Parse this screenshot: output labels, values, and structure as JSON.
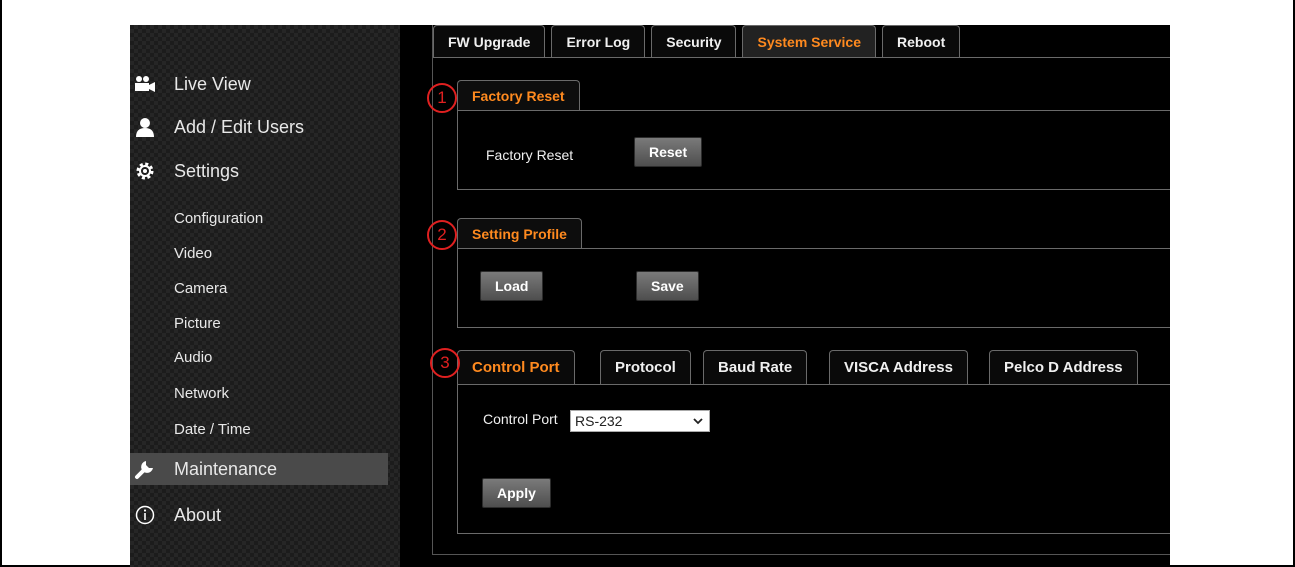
{
  "sidebar": {
    "main_items": [
      {
        "label": "Live View",
        "icon": "video-camera-icon"
      },
      {
        "label": "Add / Edit Users",
        "icon": "user-icon"
      },
      {
        "label": "Settings",
        "icon": "gear-icon"
      },
      {
        "label": "Maintenance",
        "icon": "wrench-icon"
      },
      {
        "label": "About",
        "icon": "info-icon"
      }
    ],
    "sub_items": [
      "Configuration",
      "Video",
      "Camera",
      "Picture",
      "Audio",
      "Network",
      "Date / Time"
    ],
    "active": "Maintenance"
  },
  "top_tabs": [
    "FW Upgrade",
    "Error Log",
    "Security",
    "System Service",
    "Reboot"
  ],
  "active_tab": "System Service",
  "factory_reset": {
    "marker": "1",
    "title": "Factory Reset",
    "label": "Factory Reset",
    "button": "Reset"
  },
  "setting_profile": {
    "marker": "2",
    "title": "Setting Profile",
    "load_button": "Load",
    "save_button": "Save"
  },
  "control_port": {
    "marker": "3",
    "tabs": [
      "Control Port",
      "Protocol",
      "Baud Rate",
      "VISCA Address",
      "Pelco D Address"
    ],
    "active_tab": "Control Port",
    "field_label": "Control Port",
    "selected_value": "RS-232",
    "apply_button": "Apply"
  },
  "colors": {
    "accent": "#ff8a1f",
    "marker": "#e02020",
    "background": "#000000"
  }
}
